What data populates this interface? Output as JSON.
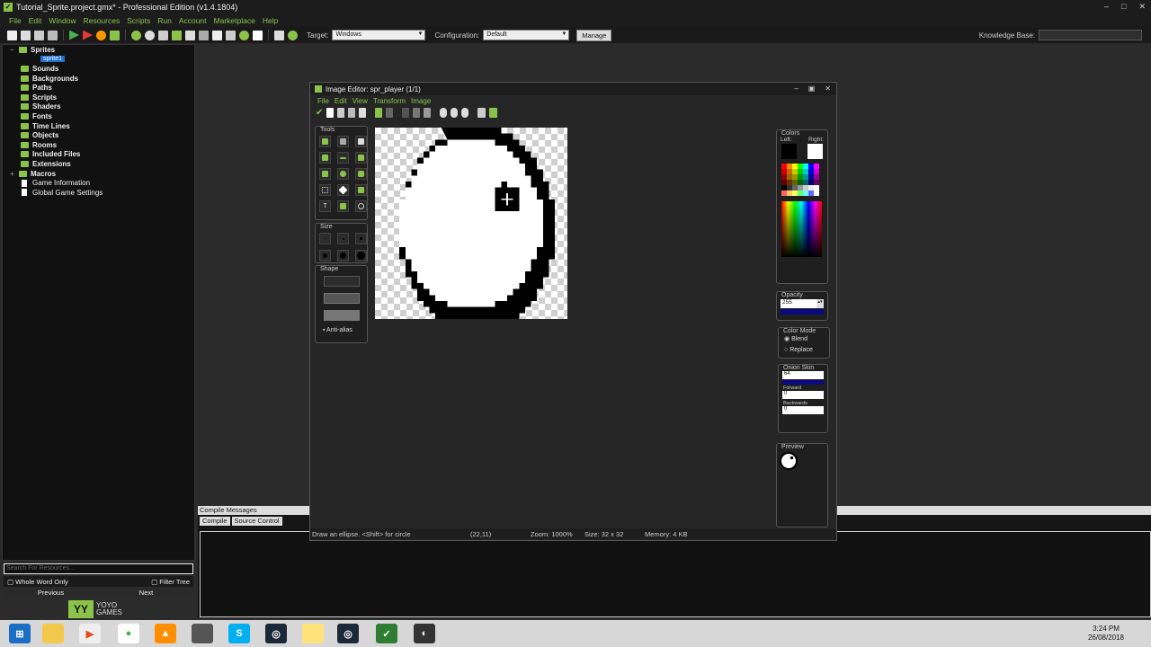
{
  "app": {
    "title": "Tutorial_Sprite.project.gmx* - Professional Edition (v1.4.1804)"
  },
  "menu": [
    "File",
    "Edit",
    "Window",
    "Resources",
    "Scripts",
    "Run",
    "Account",
    "Marketplace",
    "Help"
  ],
  "toolbar": {
    "target_label": "Target:",
    "target_value": "Windows",
    "config_label": "Configuration:",
    "config_value": "Default",
    "manage_label": "Manage"
  },
  "knowledge_base": {
    "label": "Knowledge Base:",
    "value": ""
  },
  "tree": {
    "items": [
      "Sprites",
      "sprite1",
      "Sounds",
      "Backgrounds",
      "Paths",
      "Scripts",
      "Shaders",
      "Fonts",
      "Time Lines",
      "Objects",
      "Rooms",
      "Included Files",
      "Extensions",
      "Macros",
      "Game Information",
      "Global Game Settings"
    ]
  },
  "search": {
    "placeholder": "Search For Resources..."
  },
  "options": {
    "whole_word": "Whole Word Only",
    "filter_tree": "Filter Tree",
    "previous": "Previous",
    "next": "Next"
  },
  "brand": {
    "line1": "YOYO",
    "line2": "GAMES"
  },
  "compile": {
    "title": "Compile Messages",
    "tabs": [
      "Compile",
      "Source Control"
    ]
  },
  "editor": {
    "title": "Image Editor: spr_player (1/1)",
    "menu": [
      "File",
      "Edit",
      "View",
      "Transform",
      "Image"
    ],
    "tools_label": "Tools",
    "size_label": "Size",
    "shape_label": "Shape",
    "antialias_label": "Anti-alias",
    "colors": {
      "label": "Colors",
      "left_label": "Left:",
      "right_label": "Right:",
      "left_color": "#000000",
      "right_color": "#ffffff"
    },
    "opacity": {
      "label": "Opacity",
      "value": "255"
    },
    "color_mode": {
      "label": "Color Mode",
      "options": [
        "Blend",
        "Replace"
      ],
      "selected": "Blend"
    },
    "onion": {
      "label": "Onion Skin",
      "value": "64",
      "forward_label": "Forward",
      "forward": "0",
      "backwards_label": "Backwards",
      "backwards": "0"
    },
    "preview_label": "Preview",
    "status": {
      "hint": "Draw an ellipse. <Shift> for circle",
      "coords": "(22,11)",
      "zoom": "Zoom: 1000%",
      "size": "Size: 32 x 32",
      "memory": "Memory: 4 KB"
    }
  },
  "clock": {
    "time": "3:24 PM",
    "date": "26/08/2018"
  }
}
